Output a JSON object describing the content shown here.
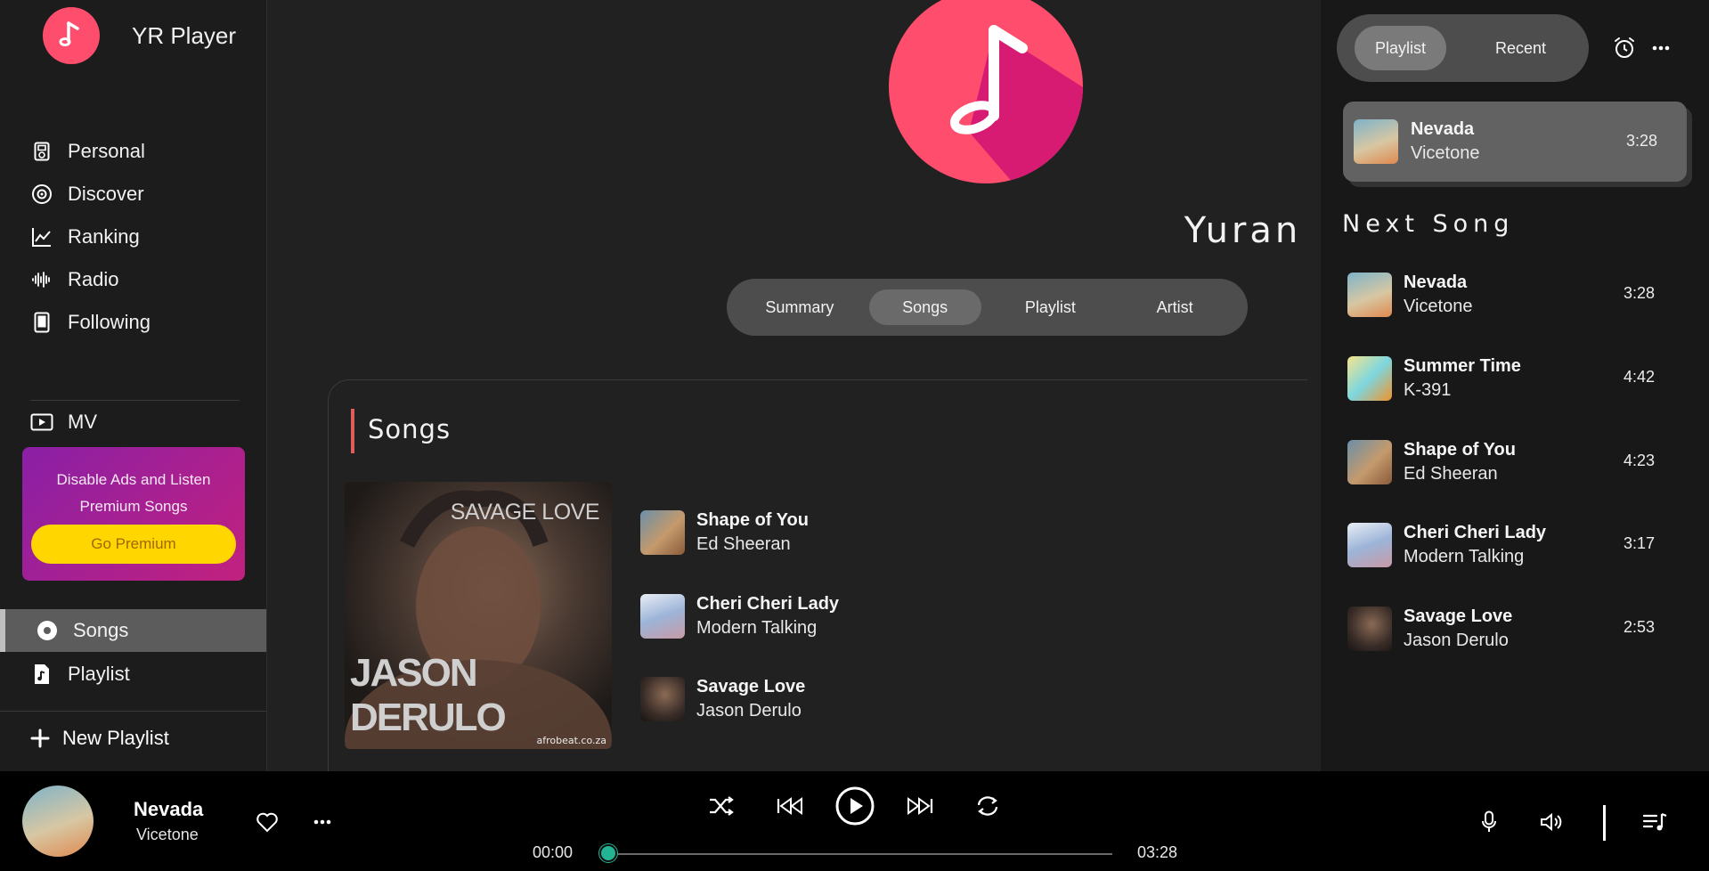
{
  "app": {
    "name": "YR Player"
  },
  "nav": [
    {
      "label": "Personal",
      "icon": "ipod-icon"
    },
    {
      "label": "Discover",
      "icon": "disc-icon"
    },
    {
      "label": "Ranking",
      "icon": "chart-line-icon"
    },
    {
      "label": "Radio",
      "icon": "waveform-icon"
    },
    {
      "label": "Following",
      "icon": "tablet-icon"
    }
  ],
  "mv": {
    "label": "MV"
  },
  "premium": {
    "text": "Disable Ads and Listen Premium Songs",
    "button": "Go Premium"
  },
  "library": [
    {
      "label": "Songs",
      "active": true
    },
    {
      "label": "Playlist",
      "active": false
    }
  ],
  "new_playlist": "New Playlist",
  "profile": {
    "name": "Yuran"
  },
  "tabs": [
    {
      "label": "Summary",
      "active": false
    },
    {
      "label": "Songs",
      "active": true
    },
    {
      "label": "Playlist",
      "active": false
    },
    {
      "label": "Artist",
      "active": false
    }
  ],
  "songs_section": {
    "title": "Songs",
    "cover": {
      "title": "SAVAGE LOVE",
      "artist": "JASON DERULO",
      "source": "afrobeat.co.za"
    },
    "items": [
      {
        "title": "Shape of You",
        "artist": "Ed Sheeran"
      },
      {
        "title": "Cheri Cheri Lady",
        "artist": "Modern Talking"
      },
      {
        "title": "Savage Love",
        "artist": "Jason Derulo"
      }
    ]
  },
  "right_panel": {
    "tabs": [
      {
        "label": "Playlist",
        "active": true
      },
      {
        "label": "Recent",
        "active": false
      }
    ],
    "now_playing": {
      "title": "Nevada",
      "artist": "Vicetone",
      "duration": "3:28"
    },
    "next_title": "Next Song",
    "queue": [
      {
        "title": "Nevada",
        "artist": "Vicetone",
        "duration": "3:28"
      },
      {
        "title": "Summer Time",
        "artist": "K-391",
        "duration": "4:42"
      },
      {
        "title": "Shape of You",
        "artist": "Ed Sheeran",
        "duration": "4:23"
      },
      {
        "title": "Cheri Cheri Lady",
        "artist": "Modern Talking",
        "duration": "3:17"
      },
      {
        "title": "Savage Love",
        "artist": "Jason Derulo",
        "duration": "2:53"
      }
    ]
  },
  "player": {
    "title": "Nevada",
    "artist": "Vicetone",
    "current_time": "00:00",
    "total_time": "03:28",
    "progress": 0
  },
  "colors": {
    "accent": "#ff4d6d",
    "progress_knob": "#23b593",
    "premium_button": "#ffd600"
  }
}
